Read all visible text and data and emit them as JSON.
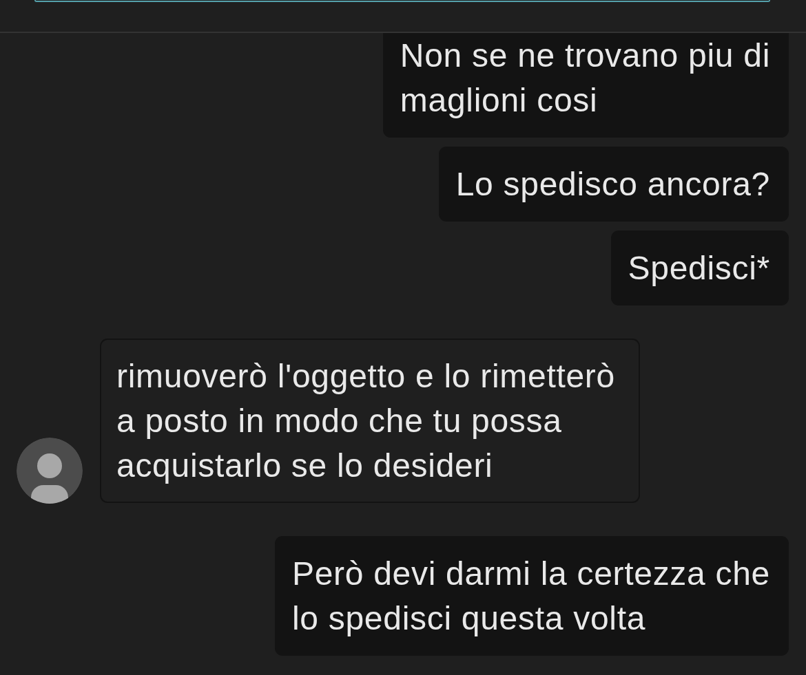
{
  "messages": [
    {
      "kind": "sent",
      "text": "Non se ne trovano piu di\nmaglioni cosi"
    },
    {
      "kind": "sent",
      "text": "Lo spedisco ancora?"
    },
    {
      "kind": "sent",
      "text": "Spedisci*"
    },
    {
      "kind": "received",
      "text": "rimuoverò l'oggetto e lo rimetterò\na posto in modo che tu possa\nacquistarlo se lo desideri"
    },
    {
      "kind": "sent",
      "text": "Però devi darmi la certezza che\nlo spedisci questa volta"
    }
  ]
}
